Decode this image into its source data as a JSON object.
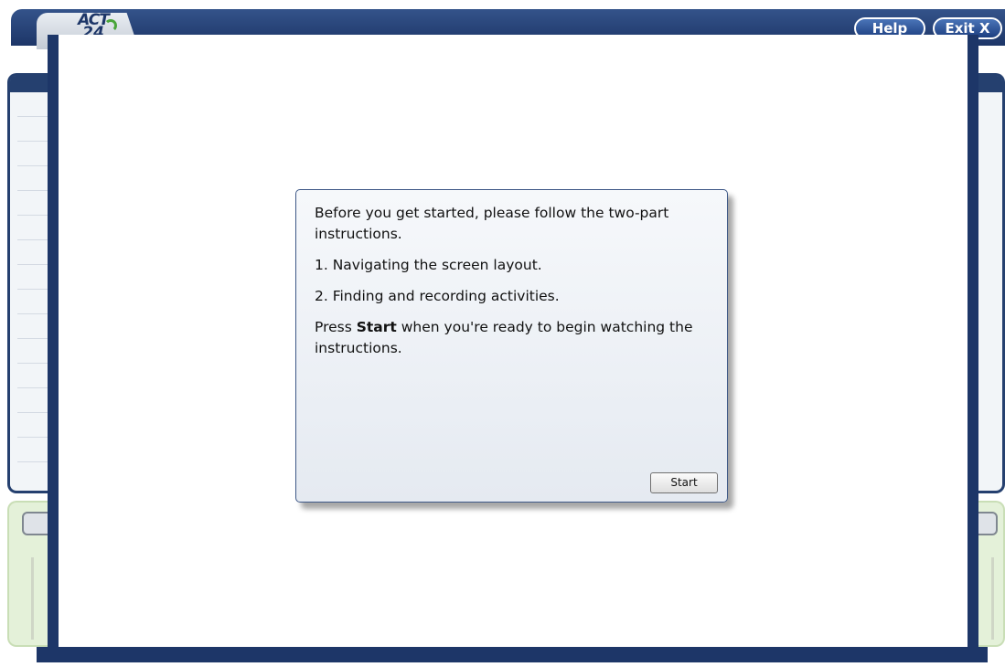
{
  "header": {
    "logo_line1": "ACT",
    "logo_line2": "24",
    "help_label": "Help",
    "exit_label": "Exit X"
  },
  "dialog": {
    "intro": "Before you get started, please follow the two-part instructions.",
    "step1": "1. Navigating the screen layout.",
    "step2": "2. Finding and recording activities.",
    "press_prefix": "Press ",
    "press_bold": "Start",
    "press_suffix": " when you're ready to begin watching the instructions.",
    "start_label": "Start"
  },
  "colors": {
    "frame_navy": "#1d3668",
    "button_blue": "#2f5597",
    "logo_green": "#4aa53a",
    "dialog_border": "#3e5887"
  }
}
